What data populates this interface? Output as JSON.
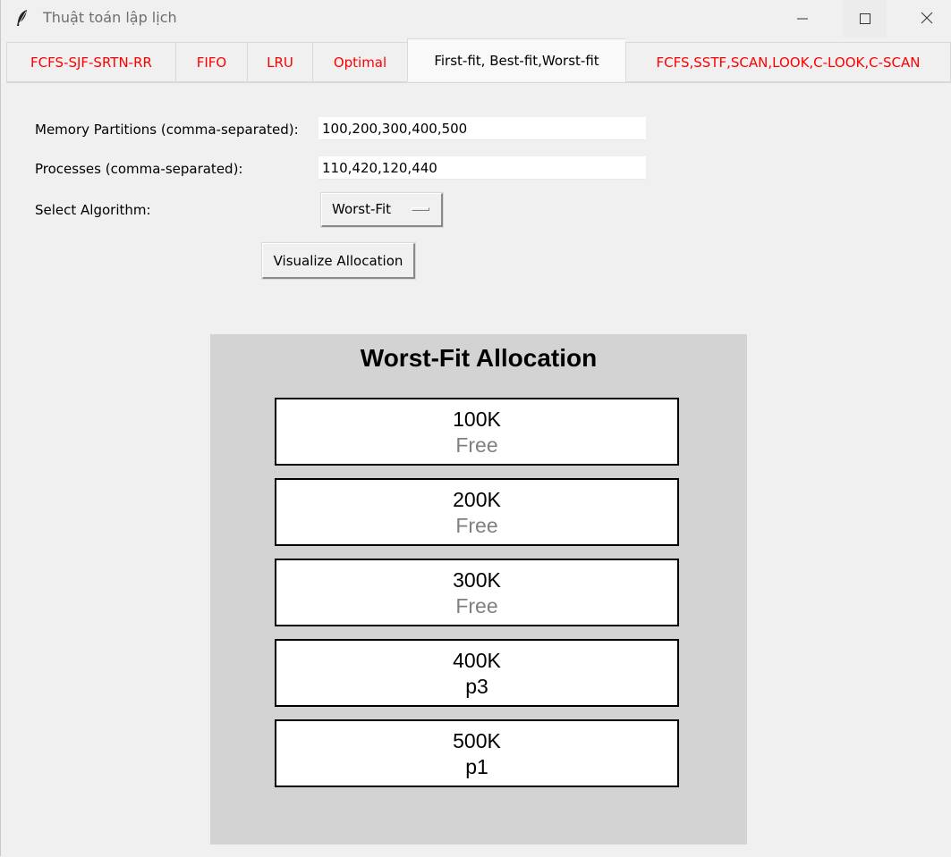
{
  "window": {
    "title": "Thuật toán lập lịch"
  },
  "tabs": [
    {
      "label": "FCFS-SJF-SRTN-RR",
      "active": false
    },
    {
      "label": "FIFO",
      "active": false
    },
    {
      "label": "LRU",
      "active": false
    },
    {
      "label": "Optimal",
      "active": false
    },
    {
      "label": "First-fit, Best-fit,Worst-fit",
      "active": true
    },
    {
      "label": "FCFS,SSTF,SCAN,LOOK,C-LOOK,C-SCAN",
      "active": false
    }
  ],
  "form": {
    "partitions_label": "Memory Partitions (comma-separated):",
    "partitions_value": "100,200,300,400,500",
    "processes_label": "Processes (comma-separated):",
    "processes_value": "110,420,120,440",
    "algorithm_label": "Select Algorithm:",
    "algorithm_value": "Worst-Fit",
    "visualize_label": "Visualize Allocation"
  },
  "canvas": {
    "title": "Worst-Fit Allocation",
    "blocks": [
      {
        "size": "100K",
        "status": "Free"
      },
      {
        "size": "200K",
        "status": "Free"
      },
      {
        "size": "300K",
        "status": "Free"
      },
      {
        "size": "400K",
        "status": "p3"
      },
      {
        "size": "500K",
        "status": "p1"
      }
    ]
  },
  "colors": {
    "inactive_tab_text": "#ff0000",
    "free_text": "#808080",
    "canvas_bg": "#d3d3d3"
  }
}
